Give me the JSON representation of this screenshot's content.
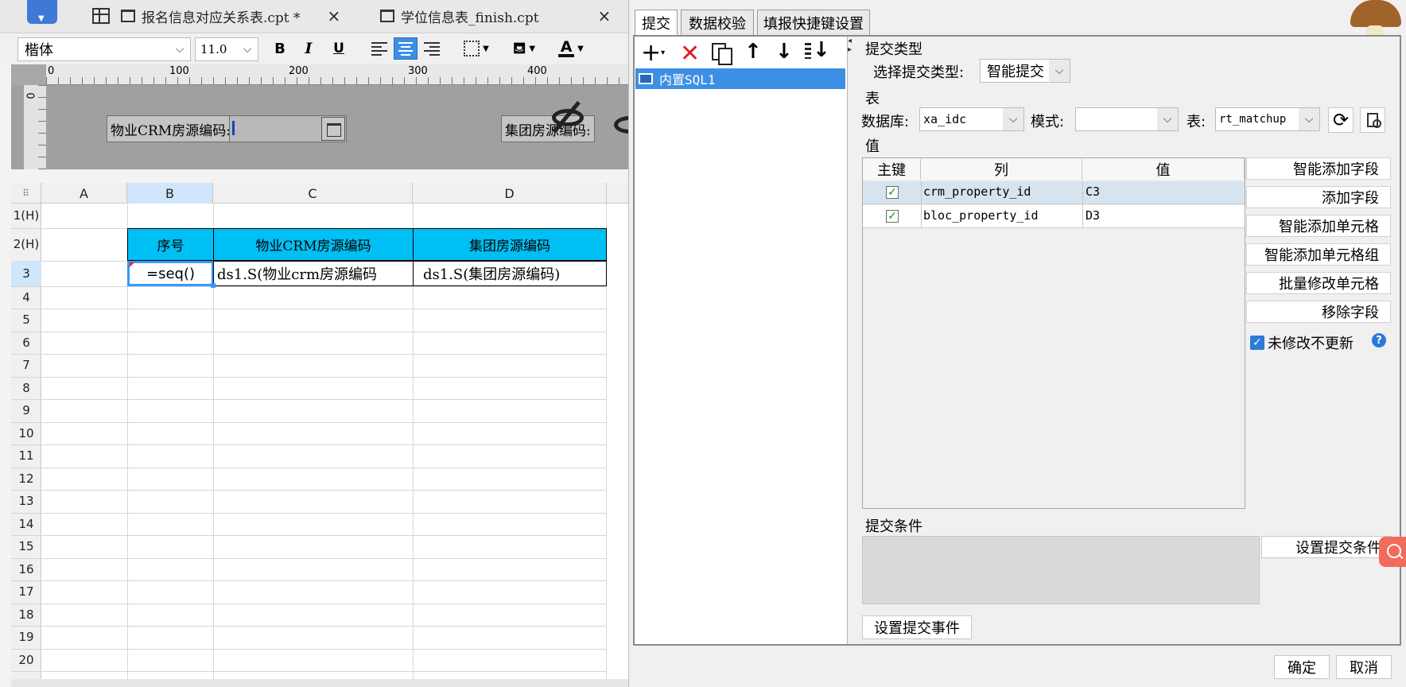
{
  "tabs": [
    {
      "label": "报名信息对应关系表.cpt *",
      "close": "×"
    },
    {
      "label": "学位信息表_finish.cpt",
      "close": "×"
    }
  ],
  "toolbar": {
    "font_name": "楷体",
    "font_size": "11.0",
    "bold": "B",
    "italic": "I",
    "underline": "U",
    "font_color_label": "A"
  },
  "ruler": {
    "ticks": [
      "0",
      "100",
      "200",
      "300",
      "400"
    ]
  },
  "param_panel": {
    "label1": "物业CRM房源编码:",
    "label2": "集团房源编码:",
    "vertical_tick": "0"
  },
  "sheet": {
    "columns": [
      "A",
      "B",
      "C",
      "D"
    ],
    "rows": [
      "1(H)",
      "2(H)",
      "3",
      "4",
      "5",
      "6",
      "7",
      "8",
      "9",
      "10",
      "11",
      "12",
      "13",
      "14",
      "15",
      "16",
      "17",
      "18",
      "19",
      "20"
    ],
    "header_cells": [
      "序号",
      "物业CRM房源编码",
      "集团房源编码"
    ],
    "formula_cells": [
      "=seq()",
      "ds1.S(物业crm房源编码",
      "ds1.S(集团房源编码)"
    ]
  },
  "dialog": {
    "tabs": [
      "提交",
      "数据校验",
      "填报快捷键设置"
    ],
    "list_item": "内置SQL1",
    "submit_type_section": "提交类型",
    "submit_type_label": "选择提交类型:",
    "submit_type_value": "智能提交",
    "table_section": "表",
    "db_label": "数据库:",
    "db_value": "xa_idc",
    "schema_label": "模式:",
    "schema_value": "",
    "table_label": "表:",
    "table_value": "rt_matchup",
    "value_section": "值",
    "columns": [
      "主键",
      "列",
      "值"
    ],
    "rows": [
      {
        "key": true,
        "column": "crm_property_id",
        "value": "C3"
      },
      {
        "key": true,
        "column": "bloc_property_id",
        "value": "D3"
      }
    ],
    "side_buttons": [
      "智能添加字段",
      "添加字段",
      "智能添加单元格",
      "智能添加单元格组",
      "批量修改单元格",
      "移除字段"
    ],
    "no_update_label": "未修改不更新",
    "condition_section": "提交条件",
    "set_condition": "设置提交条件",
    "set_event": "设置提交事件",
    "ok": "确定",
    "cancel": "取消",
    "help": "?"
  },
  "colors": {
    "header_fill": "#00bff3",
    "selection": "#3399ff",
    "dialog_list_sel": "#3d8fe6",
    "search_btn": "#f26b5b"
  }
}
